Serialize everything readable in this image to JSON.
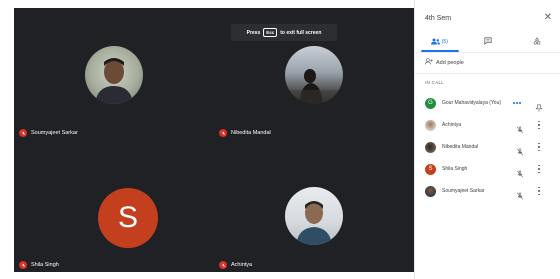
{
  "stage": {
    "escape_hint": {
      "prefix": "Press",
      "key": "Esc",
      "suffix": "to exit full screen"
    },
    "tiles": [
      {
        "name": "Soumyajeet Sarkar",
        "kind": "photo"
      },
      {
        "name": "Nibedita Mandal",
        "kind": "photo"
      },
      {
        "name": "Shila Singh",
        "kind": "letter",
        "letter": "S"
      },
      {
        "name": "Achintya",
        "kind": "photo"
      }
    ]
  },
  "panel": {
    "title": "4th Sem",
    "close_icon": "close-icon",
    "tabs": [
      {
        "name": "people",
        "icon": "people-icon",
        "count": "(5)"
      },
      {
        "name": "chat",
        "icon": "chat-icon"
      },
      {
        "name": "activities",
        "icon": "activities-icon"
      }
    ],
    "add_people": "Add people",
    "section_label": "IN CALL",
    "participants": [
      {
        "name": "Gour Mahavidyalaya (You)",
        "avatar": "G",
        "avatar_color": "#1e8e3e",
        "action": "more-dots",
        "right_icon": "pin-icon"
      },
      {
        "name": "Achintya",
        "avatar": "",
        "avatar_color": "#c7b8a8",
        "action": "mic-off-icon",
        "right_icon": "kebab-icon"
      },
      {
        "name": "Nibedita Mandal",
        "avatar": "",
        "avatar_color": "#6b5a4f",
        "action": "mic-off-icon",
        "right_icon": "kebab-icon"
      },
      {
        "name": "Shila Singh",
        "avatar": "S",
        "avatar_color": "#c43f1e",
        "action": "mic-off-icon",
        "right_icon": "kebab-icon"
      },
      {
        "name": "Soumyajeet Sarkar",
        "avatar": "",
        "avatar_color": "#4a4a4a",
        "action": "mic-off-icon",
        "right_icon": "kebab-icon"
      }
    ]
  },
  "colors": {
    "stage_bg": "#202124",
    "accent": "#1a73e8",
    "muted_red": "#d93025",
    "letter_avatar": "#c43f1e"
  }
}
